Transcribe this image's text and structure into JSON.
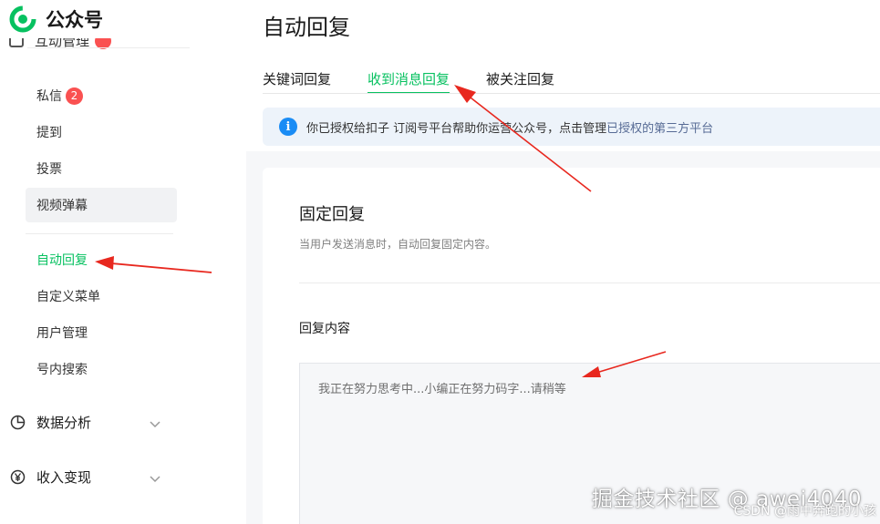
{
  "app": {
    "name": "公众号"
  },
  "sidebar": {
    "cut_item_label": "互动管理",
    "items": [
      {
        "label": "私信",
        "badge": "2"
      },
      {
        "label": "提到"
      },
      {
        "label": "投票"
      },
      {
        "label": "视频弹幕"
      },
      {
        "label": "自动回复"
      },
      {
        "label": "自定义菜单"
      },
      {
        "label": "用户管理"
      },
      {
        "label": "号内搜索"
      }
    ],
    "groups": [
      {
        "label": "数据分析",
        "icon": "chart-icon"
      },
      {
        "label": "收入变现",
        "icon": "yen-icon"
      }
    ]
  },
  "page": {
    "title": "自动回复"
  },
  "tabs": [
    {
      "label": "关键词回复"
    },
    {
      "label": "收到消息回复"
    },
    {
      "label": "被关注回复"
    }
  ],
  "notice": {
    "text": "你已授权给扣子 订阅号平台帮助你运营公众号，点击管理",
    "link": "已授权的第三方平台"
  },
  "section": {
    "title": "固定回复",
    "description": "当用户发送消息时，自动回复固定内容。",
    "field_label": "回复内容",
    "reply_text": "我正在努力思考中...小编正在努力码字...请稍等"
  },
  "watermark": {
    "main": "掘金技术社区 @ awei4040",
    "sub": "CSDN @雨中奔跑的小孩"
  },
  "colors": {
    "accent": "#07c160",
    "badge": "#fa5151",
    "info": "#1a8cf5",
    "link": "#576b95",
    "arrow": "#e8281f"
  }
}
